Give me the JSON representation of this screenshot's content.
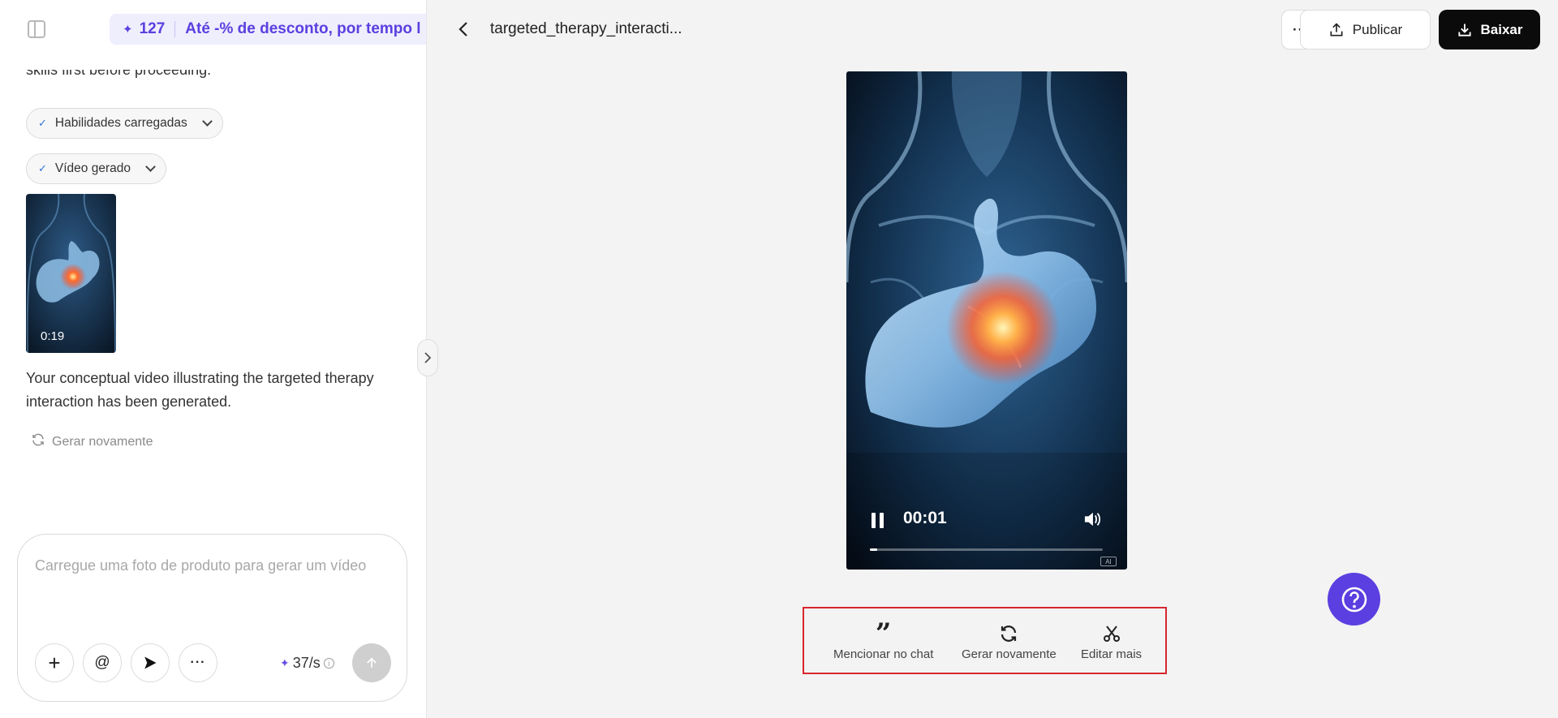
{
  "promo": {
    "credits": "127",
    "text": "Até -% de desconto, por tempo l"
  },
  "chat": {
    "cut_text": "skills first before proceeding.",
    "pill_skills": "Habilidades carregadas",
    "pill_video": "Vídeo gerado",
    "thumb_duration": "0:19",
    "message": "Your conceptual video illustrating the targeted therapy interaction has been generated.",
    "regen_label": "Gerar novamente"
  },
  "composer": {
    "placeholder": "Carregue uma foto de produto para gerar um vídeo",
    "credits_rate": "37/s",
    "add_icon": "+",
    "mention_icon": "@",
    "more_icon": "···"
  },
  "header": {
    "title": "targeted_therapy_interacti...",
    "more_icon": "···",
    "publish_label": "Publicar",
    "download_label": "Baixar"
  },
  "player": {
    "time": "00:01",
    "progress": 0.03,
    "ai_badge": "AI"
  },
  "actions": {
    "mention_label": "Mencionar no chat",
    "regen_label": "Gerar novamente",
    "edit_label": "Editar mais"
  },
  "colors": {
    "accent": "#5b3fe0",
    "highlight": "#d7262e"
  },
  "icons": [
    "sidebar-toggle-icon",
    "sparkle-icon",
    "check-icon",
    "chevron-down-icon",
    "refresh-icon",
    "plus-icon",
    "at-icon",
    "send-arrow-icon",
    "more-icon",
    "info-icon",
    "arrow-up-icon",
    "chevron-right-icon",
    "back-arrow-icon",
    "upload-icon",
    "download-icon",
    "pause-icon",
    "volume-icon",
    "quote-icon",
    "scissors-icon",
    "help-icon"
  ]
}
